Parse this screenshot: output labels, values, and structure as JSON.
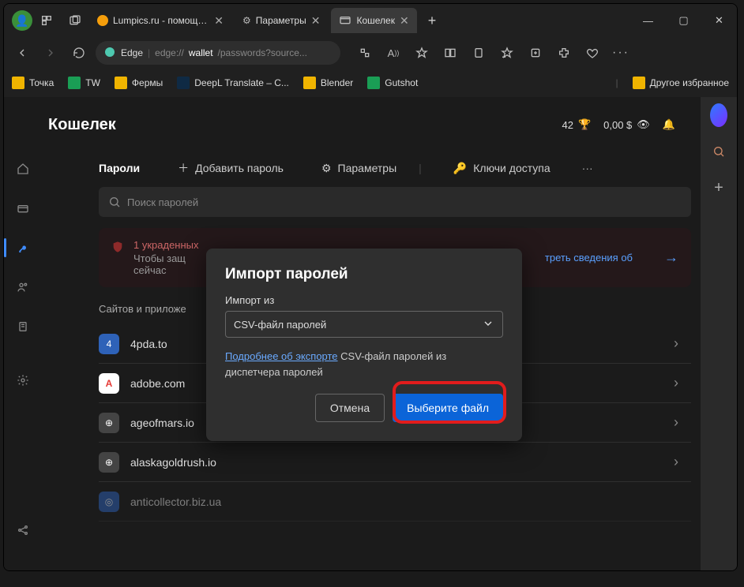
{
  "tabs": [
    {
      "label": "Lumpics.ru - помощь с...",
      "favicon": "#f59e0b",
      "active": false
    },
    {
      "label": "Параметры",
      "favicon": "#555",
      "active": false
    },
    {
      "label": "Кошелек",
      "favicon": "#555",
      "active": true
    }
  ],
  "url": {
    "prefix": "Edge",
    "grey1": "edge://",
    "white": "wallet",
    "grey2": "/passwords?source..."
  },
  "bookmarks": [
    {
      "label": "Точка",
      "color": "#f0b400"
    },
    {
      "label": "TW",
      "color": "#1a9e55"
    },
    {
      "label": "Фермы",
      "color": "#f0b400"
    },
    {
      "label": "DeepL Translate – C...",
      "color": "#0f2a44"
    },
    {
      "label": "Blender",
      "color": "#f0b400"
    },
    {
      "label": "Gutshot",
      "color": "#1a9e55"
    }
  ],
  "bookmarks_other": "Другое избранное",
  "page": {
    "title": "Кошелек",
    "reward_count": "42",
    "balance": "0,00 $",
    "subhead_title": "Пароли",
    "add_password": "Добавить пароль",
    "params": "Параметры",
    "access_keys": "Ключи доступа",
    "search_placeholder": "Поиск паролей",
    "alert_title": "1 украденных",
    "alert_text1": "Чтобы защ",
    "alert_text2": "сейчас",
    "alert_link": "треть сведения об",
    "section_label": "Сайтов и приложе"
  },
  "sites": [
    {
      "name": "4pda.to",
      "bg": "#2e62b8",
      "txt": "4"
    },
    {
      "name": "adobe.com",
      "bg": "#fff",
      "txt": "A",
      "txtcolor": "#e53935"
    },
    {
      "name": "ageofmars.io",
      "bg": "#444",
      "txt": "⊕"
    },
    {
      "name": "alaskagoldrush.io",
      "bg": "#444",
      "txt": "⊕"
    },
    {
      "name": "anticollector.biz.ua",
      "bg": "#2e62b8",
      "txt": "○"
    }
  ],
  "dialog": {
    "title": "Импорт паролей",
    "import_from": "Импорт из",
    "select_value": "CSV-файл паролей",
    "help_link": "Подробнее об экспорте",
    "help_text": " CSV-файл паролей из диспетчера паролей",
    "cancel": "Отмена",
    "choose": "Выберите файл"
  }
}
